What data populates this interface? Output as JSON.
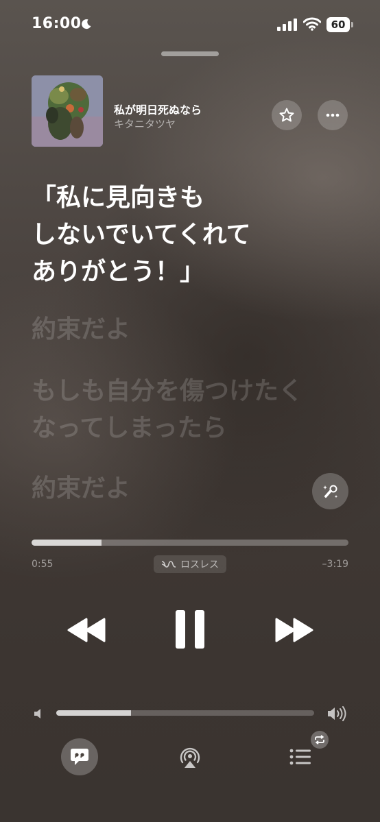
{
  "status_bar": {
    "time": "16:00",
    "battery": "60"
  },
  "now_playing": {
    "title": "私が明日死ぬなら",
    "artist": "キタニタツヤ"
  },
  "lyrics": {
    "active": [
      "「私に見向きも",
      "しないでいてくれて",
      "ありがとう！」"
    ],
    "upcoming": [
      [
        "約束だよ"
      ],
      [
        "もしも自分を傷つけたく",
        "なってしまったら"
      ],
      [
        "約束だよ"
      ]
    ]
  },
  "playback": {
    "elapsed": "0:55",
    "remaining": "–3:19",
    "progress": 0.22,
    "quality_label": "ロスレス"
  },
  "volume": {
    "level": 0.29
  },
  "icons": {
    "status": [
      "moon-icon",
      "cellular-signal-icon",
      "wifi-icon",
      "battery-icon"
    ],
    "header": [
      "star-icon",
      "more-icon"
    ],
    "lyrics": "sing-microphone-icon",
    "transport": [
      "rewind-icon",
      "pause-icon",
      "fast-forward-icon"
    ],
    "volume": [
      "volume-low-icon",
      "volume-high-icon"
    ],
    "bottom": [
      "lyrics-icon",
      "airplay-icon",
      "queue-icon",
      "repeat-icon"
    ]
  },
  "colors": {
    "background_top": "#5a544f",
    "background_bottom": "#3a3430",
    "text_primary": "#ffffff"
  }
}
